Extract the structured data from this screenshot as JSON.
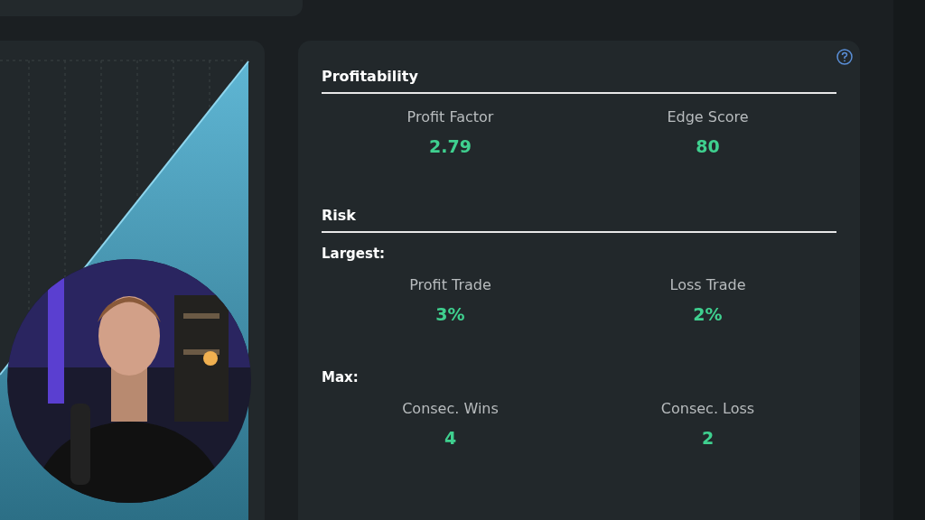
{
  "sections": [
    {
      "title": "Profitability",
      "groups": [
        {
          "stats": [
            {
              "label": "Profit Factor",
              "value": "2.79"
            },
            {
              "label": "Edge Score",
              "value": "80"
            }
          ]
        }
      ]
    },
    {
      "title": "Risk",
      "groups": [
        {
          "subtitle": "Largest:",
          "stats": [
            {
              "label": "Profit Trade",
              "value": "3%"
            },
            {
              "label": "Loss Trade",
              "value": "2%"
            }
          ]
        },
        {
          "subtitle": "Max:",
          "stats": [
            {
              "label": "Consec. Wins",
              "value": "4"
            },
            {
              "label": "Consec. Loss",
              "value": "2"
            }
          ]
        }
      ]
    }
  ]
}
